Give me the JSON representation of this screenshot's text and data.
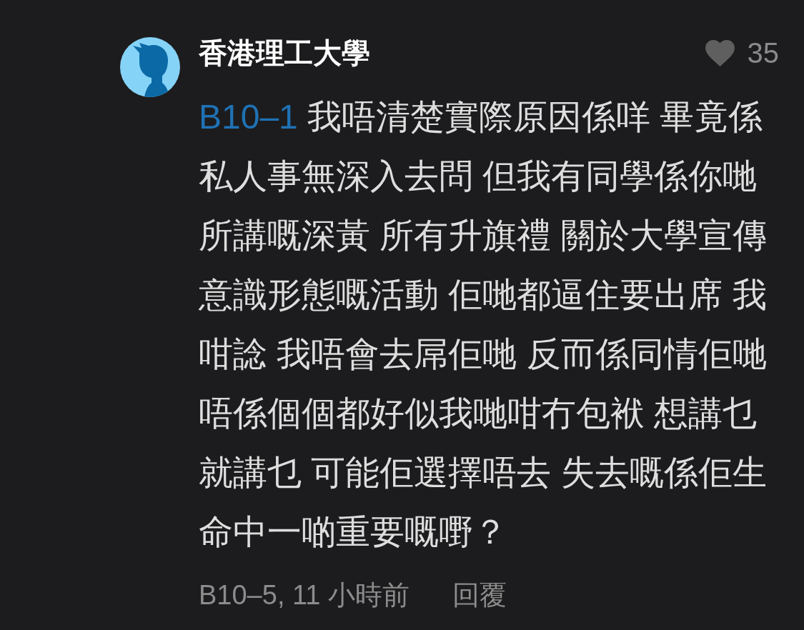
{
  "comment": {
    "author": "香港理工大學",
    "likes": {
      "count": "35",
      "liked": false
    },
    "body": {
      "reply_to": "B10–1",
      "text": "我唔清楚實際原因係咩 畢竟係私人事無深入去問 但我有同學係你哋所講嘅深黃 所有升旗禮 關於大學宣傳意識形態嘅活動 佢哋都逼住要出席 我咁諗 我唔會去屌佢哋 反而係同情佢哋唔係個個都好似我哋咁冇包袱 想講乜就講乜 可能佢選擇唔去 失去嘅係佢生命中一啲重要嘅嘢？"
    },
    "footer": {
      "meta": "B10–5, 11 小時前",
      "reply": "回覆"
    }
  }
}
